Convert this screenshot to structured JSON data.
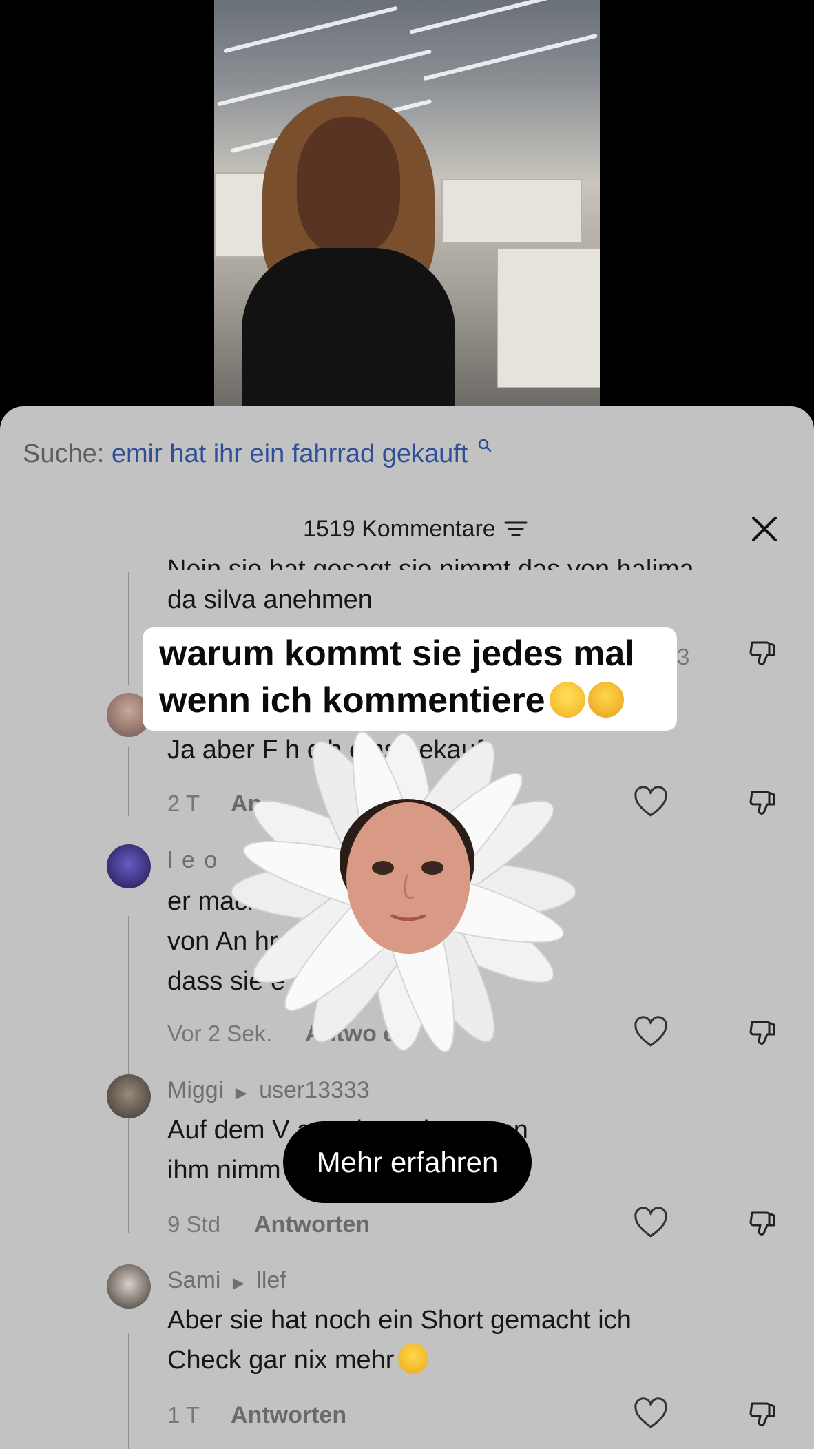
{
  "search": {
    "prefix": "Suche:",
    "query": "emir hat ihr ein fahrrad gekauft",
    "icon": "search-icon"
  },
  "comments_header": {
    "count_label": "1519 Kommentare",
    "filter_icon": "filter-icon",
    "close_icon": "close-icon"
  },
  "caption_overlay": {
    "line1": "warum kommt sie jedes mal",
    "line2": "wenn ich kommentiere",
    "emojis": [
      "grinning-face",
      "loudly-crying-face"
    ]
  },
  "comments": [
    {
      "text_partial": "Nein sie hat gesagt sie nimmt das von halima",
      "text_line2": "da silva anehmen",
      "like_count_partial": "3"
    },
    {
      "text": "Ja aber F     h        c   h eins gekauft",
      "meta": "2 T",
      "reply": "An"
    },
    {
      "username": "l e o",
      "text_line1": "er mach                                           Klicks. Sie hat",
      "text_line2": "von An                                        hr lieber wär,",
      "text_line3": "dass sie e",
      "meta": "Vor 2 Sek.",
      "reply": "Antwo   e"
    },
    {
      "username": "Miggi",
      "reply_to": "user13333",
      "text_line1": "Auf dem V                       agt, dass sie es von",
      "text_line2": "ihm nimm",
      "meta": "9 Std",
      "reply": "Antworten"
    },
    {
      "username": "Sami",
      "reply_to": "llef",
      "text_line1": "Aber sie hat noch ein Short gemacht ich",
      "text_line2": "Check gar nix mehr",
      "meta": "1 T",
      "reply": "Antworten"
    }
  ],
  "more_button": {
    "label": "Mehr erfahren"
  },
  "colors": {
    "sheet_bg": "#c2c2c2",
    "search_query": "#2f4f96",
    "caption_bg": "#ffffff",
    "more_button_bg": "#000000"
  }
}
